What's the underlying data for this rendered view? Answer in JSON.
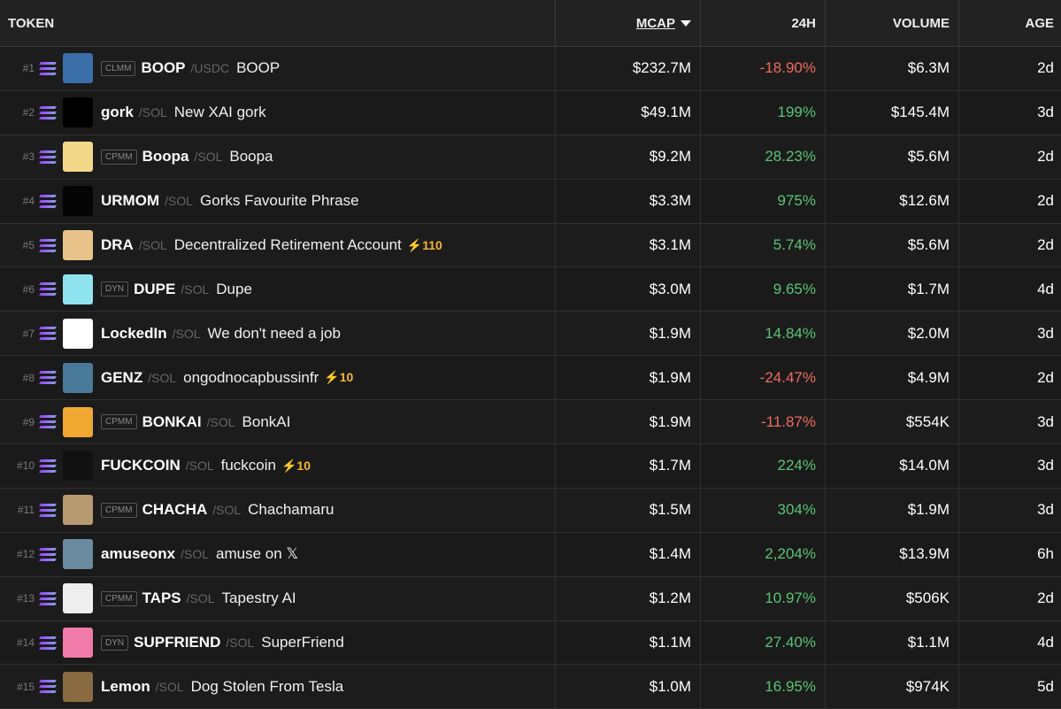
{
  "header": {
    "token": "TOKEN",
    "mcap": "MCAP",
    "change24h": "24H",
    "volume": "VOLUME",
    "age": "AGE"
  },
  "colors": {
    "positive": "#5bc374",
    "negative": "#f06a5f",
    "boost": "#f5b731"
  },
  "rows": [
    {
      "rank": "#1",
      "pool": "CLMM",
      "symbol": "BOOP",
      "quote": "/USDC",
      "name": "BOOP",
      "boost": "",
      "mcap": "$232.7M",
      "change": "-18.90%",
      "dir": "neg",
      "volume": "$6.3M",
      "age": "2d",
      "avatar_bg": "#3a6ea8"
    },
    {
      "rank": "#2",
      "pool": "",
      "symbol": "gork",
      "quote": "/SOL",
      "name": "New XAI gork",
      "boost": "",
      "mcap": "$49.1M",
      "change": "199%",
      "dir": "pos",
      "volume": "$145.4M",
      "age": "3d",
      "avatar_bg": "#000000"
    },
    {
      "rank": "#3",
      "pool": "CPMM",
      "symbol": "Boopa",
      "quote": "/SOL",
      "name": "Boopa",
      "boost": "",
      "mcap": "$9.2M",
      "change": "28.23%",
      "dir": "pos",
      "volume": "$5.6M",
      "age": "2d",
      "avatar_bg": "#f3d88a"
    },
    {
      "rank": "#4",
      "pool": "",
      "symbol": "URMOM",
      "quote": "/SOL",
      "name": "Gorks Favourite Phrase",
      "boost": "",
      "mcap": "$3.3M",
      "change": "975%",
      "dir": "pos",
      "volume": "$12.6M",
      "age": "2d",
      "avatar_bg": "#050505"
    },
    {
      "rank": "#5",
      "pool": "",
      "symbol": "DRA",
      "quote": "/SOL",
      "name": "Decentralized Retirement Account",
      "boost": "⚡110",
      "mcap": "$3.1M",
      "change": "5.74%",
      "dir": "pos",
      "volume": "$5.6M",
      "age": "2d",
      "avatar_bg": "#e8c48a"
    },
    {
      "rank": "#6",
      "pool": "DYN",
      "symbol": "DUPE",
      "quote": "/SOL",
      "name": "Dupe",
      "boost": "",
      "mcap": "$3.0M",
      "change": "9.65%",
      "dir": "pos",
      "volume": "$1.7M",
      "age": "4d",
      "avatar_bg": "#8fe3f0"
    },
    {
      "rank": "#7",
      "pool": "",
      "symbol": "LockedIn",
      "quote": "/SOL",
      "name": "We don't need a job",
      "boost": "",
      "mcap": "$1.9M",
      "change": "14.84%",
      "dir": "pos",
      "volume": "$2.0M",
      "age": "3d",
      "avatar_bg": "#ffffff"
    },
    {
      "rank": "#8",
      "pool": "",
      "symbol": "GENZ",
      "quote": "/SOL",
      "name": "ongodnocapbussinfr",
      "boost": "⚡10",
      "mcap": "$1.9M",
      "change": "-24.47%",
      "dir": "neg",
      "volume": "$4.9M",
      "age": "2d",
      "avatar_bg": "#4a7a9a"
    },
    {
      "rank": "#9",
      "pool": "CPMM",
      "symbol": "BONKAI",
      "quote": "/SOL",
      "name": "BonkAI",
      "boost": "",
      "mcap": "$1.9M",
      "change": "-11.87%",
      "dir": "neg",
      "volume": "$554K",
      "age": "3d",
      "avatar_bg": "#f0a830"
    },
    {
      "rank": "#10",
      "pool": "",
      "symbol": "FUCKCOIN",
      "quote": "/SOL",
      "name": "fuckcoin",
      "boost": "⚡10",
      "mcap": "$1.7M",
      "change": "224%",
      "dir": "pos",
      "volume": "$14.0M",
      "age": "3d",
      "avatar_bg": "#111111"
    },
    {
      "rank": "#11",
      "pool": "CPMM",
      "symbol": "CHACHA",
      "quote": "/SOL",
      "name": "Chachamaru",
      "boost": "",
      "mcap": "$1.5M",
      "change": "304%",
      "dir": "pos",
      "volume": "$1.9M",
      "age": "3d",
      "avatar_bg": "#b89a70"
    },
    {
      "rank": "#12",
      "pool": "",
      "symbol": "amuseonx",
      "quote": "/SOL",
      "name": "amuse on 𝕏",
      "boost": "",
      "mcap": "$1.4M",
      "change": "2,204%",
      "dir": "pos",
      "volume": "$13.9M",
      "age": "6h",
      "avatar_bg": "#6a8aa0"
    },
    {
      "rank": "#13",
      "pool": "CPMM",
      "symbol": "TAPS",
      "quote": "/SOL",
      "name": "Tapestry AI",
      "boost": "",
      "mcap": "$1.2M",
      "change": "10.97%",
      "dir": "pos",
      "volume": "$506K",
      "age": "2d",
      "avatar_bg": "#eeeeee"
    },
    {
      "rank": "#14",
      "pool": "DYN",
      "symbol": "SUPFRIEND",
      "quote": "/SOL",
      "name": "SuperFriend",
      "boost": "",
      "mcap": "$1.1M",
      "change": "27.40%",
      "dir": "pos",
      "volume": "$1.1M",
      "age": "4d",
      "avatar_bg": "#f07aa8"
    },
    {
      "rank": "#15",
      "pool": "",
      "symbol": "Lemon",
      "quote": "/SOL",
      "name": "Dog Stolen From Tesla",
      "boost": "",
      "mcap": "$1.0M",
      "change": "16.95%",
      "dir": "pos",
      "volume": "$974K",
      "age": "5d",
      "avatar_bg": "#8a6a40"
    }
  ]
}
